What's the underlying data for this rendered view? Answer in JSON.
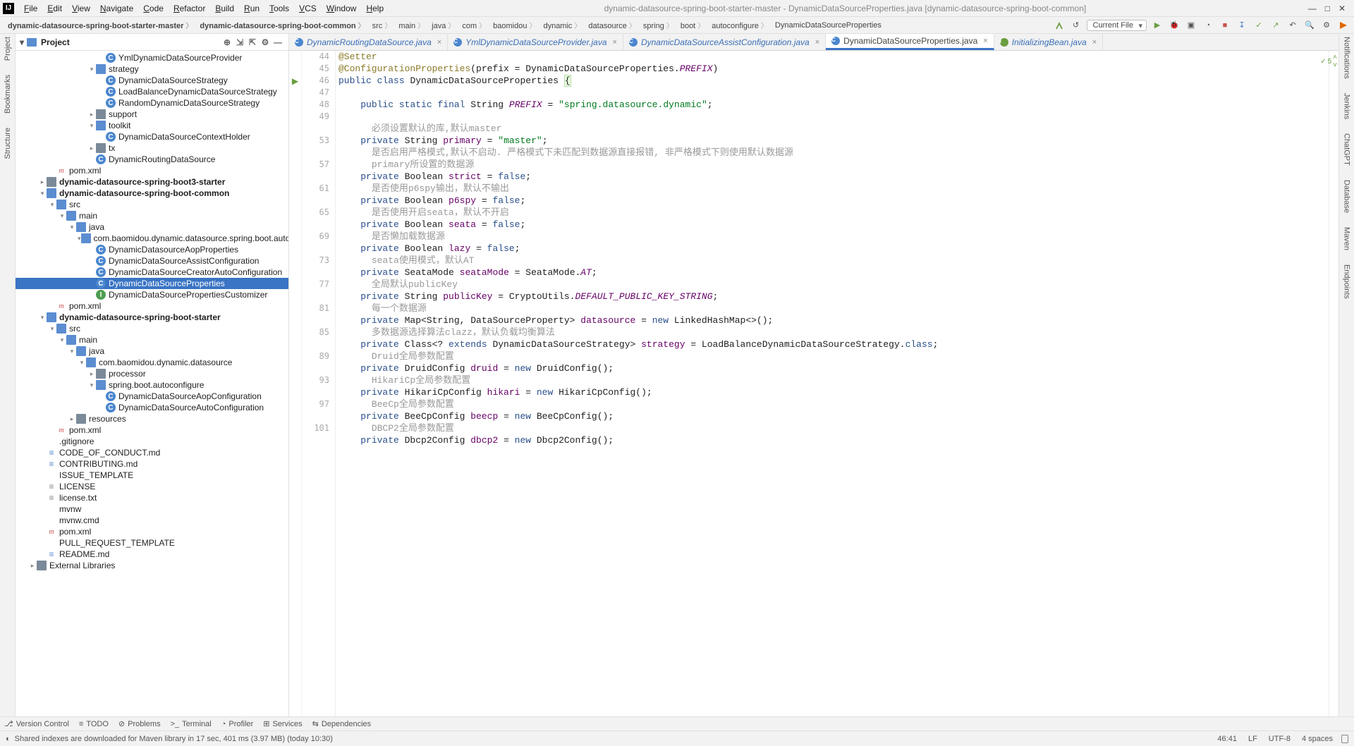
{
  "titlebar": {
    "menus": [
      "File",
      "Edit",
      "View",
      "Navigate",
      "Code",
      "Refactor",
      "Build",
      "Run",
      "Tools",
      "VCS",
      "Window",
      "Help"
    ],
    "title": "dynamic-datasource-spring-boot-starter-master - DynamicDataSourceProperties.java [dynamic-datasource-spring-boot-common]"
  },
  "breadcrumb": {
    "segs": [
      "dynamic-datasource-spring-boot-starter-master",
      "dynamic-datasource-spring-boot-common",
      "src",
      "main",
      "java",
      "com",
      "baomidou",
      "dynamic",
      "datasource",
      "spring",
      "boot",
      "autoconfigure",
      "DynamicDataSourceProperties"
    ],
    "current_file_label": "Current File"
  },
  "project": {
    "label": "Project",
    "tree": [
      {
        "depth": 8,
        "icon": "cls",
        "label": "YmlDynamicDataSourceProvider"
      },
      {
        "depth": 7,
        "chev": "v",
        "icon": "folder-open",
        "label": "strategy"
      },
      {
        "depth": 8,
        "icon": "cls",
        "label": "DynamicDataSourceStrategy"
      },
      {
        "depth": 8,
        "icon": "cls",
        "label": "LoadBalanceDynamicDataSourceStrategy"
      },
      {
        "depth": 8,
        "icon": "cls",
        "label": "RandomDynamicDataSourceStrategy"
      },
      {
        "depth": 7,
        "chev": ">",
        "icon": "folder",
        "label": "support"
      },
      {
        "depth": 7,
        "chev": "v",
        "icon": "folder-open",
        "label": "toolkit"
      },
      {
        "depth": 8,
        "icon": "cls",
        "label": "DynamicDataSourceContextHolder"
      },
      {
        "depth": 7,
        "chev": ">",
        "icon": "folder",
        "label": "tx"
      },
      {
        "depth": 7,
        "icon": "cls",
        "label": "DynamicRoutingDataSource"
      },
      {
        "depth": 3,
        "icon": "xml",
        "label": "pom.xml"
      },
      {
        "depth": 2,
        "chev": ">",
        "icon": "folder",
        "bold": true,
        "label": "dynamic-datasource-spring-boot3-starter"
      },
      {
        "depth": 2,
        "chev": "v",
        "icon": "folder-open",
        "bold": true,
        "label": "dynamic-datasource-spring-boot-common"
      },
      {
        "depth": 3,
        "chev": "v",
        "icon": "src",
        "label": "src"
      },
      {
        "depth": 4,
        "chev": "v",
        "icon": "folder-open",
        "label": "main"
      },
      {
        "depth": 5,
        "chev": "v",
        "icon": "src",
        "label": "java"
      },
      {
        "depth": 6,
        "chev": "v",
        "icon": "folder-open",
        "label": "com.baomidou.dynamic.datasource.spring.boot.autoconfigure"
      },
      {
        "depth": 7,
        "icon": "cls",
        "label": "DynamicDatasourceAopProperties"
      },
      {
        "depth": 7,
        "icon": "cls",
        "label": "DynamicDataSourceAssistConfiguration"
      },
      {
        "depth": 7,
        "icon": "cls",
        "label": "DynamicDataSourceCreatorAutoConfiguration"
      },
      {
        "depth": 7,
        "icon": "cls",
        "label": "DynamicDataSourceProperties",
        "selected": true
      },
      {
        "depth": 7,
        "icon": "cls",
        "iconVariant": "green",
        "label": "DynamicDataSourcePropertiesCustomizer"
      },
      {
        "depth": 3,
        "icon": "xml",
        "label": "pom.xml"
      },
      {
        "depth": 2,
        "chev": "v",
        "icon": "folder-open",
        "bold": true,
        "label": "dynamic-datasource-spring-boot-starter"
      },
      {
        "depth": 3,
        "chev": "v",
        "icon": "src",
        "label": "src"
      },
      {
        "depth": 4,
        "chev": "v",
        "icon": "folder-open",
        "label": "main"
      },
      {
        "depth": 5,
        "chev": "v",
        "icon": "src",
        "label": "java"
      },
      {
        "depth": 6,
        "chev": "v",
        "icon": "folder-open",
        "label": "com.baomidou.dynamic.datasource"
      },
      {
        "depth": 7,
        "chev": ">",
        "icon": "folder",
        "label": "processor"
      },
      {
        "depth": 7,
        "chev": "v",
        "icon": "folder-open",
        "label": "spring.boot.autoconfigure"
      },
      {
        "depth": 8,
        "icon": "cls",
        "label": "DynamicDataSourceAopConfiguration"
      },
      {
        "depth": 8,
        "icon": "cls",
        "label": "DynamicDataSourceAutoConfiguration"
      },
      {
        "depth": 5,
        "chev": ">",
        "icon": "folder",
        "label": "resources"
      },
      {
        "depth": 3,
        "icon": "xml",
        "label": "pom.xml"
      },
      {
        "depth": 2,
        "icon": "file",
        "label": ".gitignore"
      },
      {
        "depth": 2,
        "icon": "md",
        "label": "CODE_OF_CONDUCT.md"
      },
      {
        "depth": 2,
        "icon": "md",
        "label": "CONTRIBUTING.md"
      },
      {
        "depth": 2,
        "icon": "file",
        "label": "ISSUE_TEMPLATE"
      },
      {
        "depth": 2,
        "icon": "txt",
        "label": "LICENSE"
      },
      {
        "depth": 2,
        "icon": "txt",
        "label": "license.txt"
      },
      {
        "depth": 2,
        "icon": "file",
        "label": "mvnw"
      },
      {
        "depth": 2,
        "icon": "file",
        "label": "mvnw.cmd"
      },
      {
        "depth": 2,
        "icon": "xml",
        "label": "pom.xml"
      },
      {
        "depth": 2,
        "icon": "file",
        "label": "PULL_REQUEST_TEMPLATE"
      },
      {
        "depth": 2,
        "icon": "md",
        "label": "README.md"
      },
      {
        "depth": 1,
        "chev": ">",
        "icon": "folder",
        "label": "External Libraries"
      }
    ]
  },
  "tabs": {
    "items": [
      {
        "label": "DynamicRoutingDataSource.java",
        "color": "blue"
      },
      {
        "label": "YmlDynamicDataSourceProvider.java",
        "color": "blue"
      },
      {
        "label": "DynamicDataSourceAssistConfiguration.java",
        "color": "blue"
      },
      {
        "label": "DynamicDataSourceProperties.java",
        "color": "blue",
        "active": true
      },
      {
        "label": "InitializingBean.java",
        "color": "green"
      }
    ]
  },
  "editor": {
    "inspection_count": "5",
    "gutter": [
      "44",
      "45",
      "46",
      "47",
      "48",
      "49",
      "",
      "53",
      "",
      "57",
      "",
      "61",
      "",
      "65",
      "",
      "69",
      "",
      "73",
      "",
      "77",
      "",
      "81",
      "",
      "85",
      "",
      "89",
      "",
      "93",
      "",
      "97",
      "",
      "101"
    ],
    "code_lines": [
      {
        "html": "<span class='ann'>@Setter</span>"
      },
      {
        "html": "<span class='ann'>@ConfigurationProperties</span>(prefix = DynamicDataSourceProperties.<span class='const'>PREFIX</span>)"
      },
      {
        "html": "<span class='kw'>public</span> <span class='kw'>class</span> DynamicDataSourceProperties <span class='hl'>{</span>"
      },
      {
        "html": ""
      },
      {
        "html": "    <span class='kw'>public</span> <span class='kw'>static</span> <span class='kw'>final</span> String <span class='const'>PREFIX</span> = <span class='str'>\"spring.datasource.dynamic\"</span>;"
      },
      {
        "html": ""
      },
      {
        "html": "      <span class='com'>必须设置默认的库,默认master</span>",
        "gap": true
      },
      {
        "html": "    <span class='kw'>private</span> String <span class='fld'>primary</span> = <span class='str'>\"master\"</span>;"
      },
      {
        "html": "      <span class='com'>是否启用严格模式,默认不启动. 严格模式下未匹配到数据源直接报错, 非严格模式下则使用默认数据源</span>"
      },
      {
        "html": "      <span class='com'>primary所设置的数据源</span>"
      },
      {
        "html": "    <span class='kw'>private</span> Boolean <span class='fld'>strict</span> = <span class='kw'>false</span>;"
      },
      {
        "html": "      <span class='com'>是否使用p6spy输出，默认不输出</span>"
      },
      {
        "html": "    <span class='kw'>private</span> Boolean <span class='fld'>p6spy</span> = <span class='kw'>false</span>;"
      },
      {
        "html": "      <span class='com'>是否使用开启seata，默认不开启</span>"
      },
      {
        "html": "    <span class='kw'>private</span> Boolean <span class='fld'>seata</span> = <span class='kw'>false</span>;"
      },
      {
        "html": "      <span class='com'>是否懒加载数据源</span>"
      },
      {
        "html": "    <span class='kw'>private</span> Boolean <span class='fld'>lazy</span> = <span class='kw'>false</span>;"
      },
      {
        "html": "      <span class='com'>seata使用模式，默认AT</span>"
      },
      {
        "html": "    <span class='kw'>private</span> SeataMode <span class='fld'>seataMode</span> = SeataMode.<span class='const'>AT</span>;"
      },
      {
        "html": "      <span class='com'>全局默认publicKey</span>"
      },
      {
        "html": "    <span class='kw'>private</span> String <span class='fld'>publicKey</span> = CryptoUtils.<span class='const'>DEFAULT_PUBLIC_KEY_STRING</span>;"
      },
      {
        "html": "      <span class='com'>每一个数据源</span>"
      },
      {
        "html": "    <span class='kw'>private</span> Map&lt;String, DataSourceProperty&gt; <span class='fld'>datasource</span> = <span class='kw'>new</span> LinkedHashMap&lt;&gt;();"
      },
      {
        "html": "      <span class='com'>多数据源选择算法clazz，默认负载均衡算法</span>"
      },
      {
        "html": "    <span class='kw'>private</span> Class&lt;? <span class='kw'>extends</span> DynamicDataSourceStrategy&gt; <span class='fld'>strategy</span> = LoadBalanceDynamicDataSourceStrategy.<span class='kw'>class</span>;"
      },
      {
        "html": "      <span class='com'>Druid全局参数配置</span>"
      },
      {
        "html": "    <span class='kw'>private</span> DruidConfig <span class='fld'>druid</span> = <span class='kw'>new</span> DruidConfig();"
      },
      {
        "html": "      <span class='com'>HikariCp全局参数配置</span>"
      },
      {
        "html": "    <span class='kw'>private</span> HikariCpConfig <span class='fld'>hikari</span> = <span class='kw'>new</span> HikariCpConfig();"
      },
      {
        "html": "      <span class='com'>BeeCp全局参数配置</span>"
      },
      {
        "html": "    <span class='kw'>private</span> BeeCpConfig <span class='fld'>beecp</span> = <span class='kw'>new</span> BeeCpConfig();"
      },
      {
        "html": "      <span class='com'>DBCP2全局参数配置</span>"
      },
      {
        "html": "    <span class='kw'>private</span> Dbcp2Config <span class='fld'>dbcp2</span> = <span class='kw'>new</span> Dbcp2Config();"
      }
    ]
  },
  "left_vtabs": [
    "Project",
    "Bookmarks",
    "Structure"
  ],
  "right_vtabs": [
    "Notifications",
    "Jenkins",
    "ChatGPT",
    "Database",
    "Maven",
    "Endpoints"
  ],
  "bottombar": {
    "items": [
      "Version Control",
      "TODO",
      "Problems",
      "Terminal",
      "Profiler",
      "Services",
      "Dependencies"
    ]
  },
  "statusbar": {
    "message": "Shared indexes are downloaded for Maven library in 17 sec, 401 ms (3.97 MB) (today 10:30)",
    "pos": "46:41",
    "eol": "LF",
    "enc": "UTF-8",
    "indent": "4 spaces"
  }
}
